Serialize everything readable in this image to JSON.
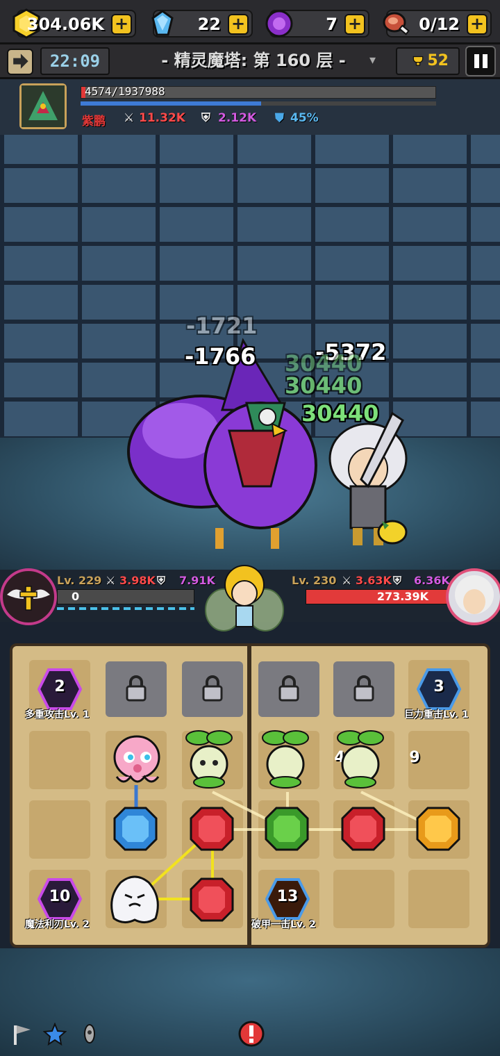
{
  "resources": {
    "gold": "304.06K",
    "diamond": "22",
    "orb": "7",
    "stamina": "0/12"
  },
  "header": {
    "timer": "22:09",
    "stage": "- 精灵魔塔: 第 160 层 -",
    "rank": "52"
  },
  "boss": {
    "hp": "4574/1937988",
    "name": "紫鹏",
    "attack": "11.32K",
    "defense": "2.12K",
    "shield": "45%"
  },
  "damage": {
    "d1": "-1721",
    "d2": "-1766",
    "d3": "-5372",
    "h1": "30440",
    "h2": "30440",
    "h3": "30440"
  },
  "player": {
    "level": "Lv. 229",
    "attack": "3.98K",
    "defense": "7.91K",
    "hp": "0"
  },
  "enemy": {
    "level": "Lv. 230",
    "attack": "3.63K",
    "defense": "6.36K",
    "hp": "273.39K"
  },
  "skills": {
    "multi_attack": {
      "count": "2",
      "label": "多重攻击Lv. 1"
    },
    "heavy_strike": {
      "count": "3",
      "label": "巨力重击Lv. 1"
    },
    "magic_blade": {
      "count": "10",
      "label": "魔法利刃Lv. 2"
    },
    "armor_break": {
      "count": "13",
      "label": "破甲一击Lv. 2"
    }
  },
  "units": {
    "sprout_a": "4",
    "sprout_b": "9"
  },
  "colors": {
    "gold": "#f2c21f",
    "hp_red": "#e23838",
    "heal_green": "#7de07a",
    "board_bg": "#d4bb86"
  }
}
